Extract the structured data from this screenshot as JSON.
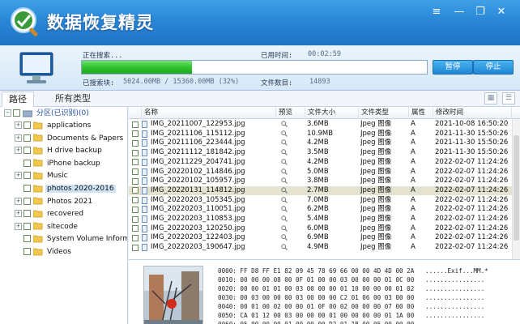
{
  "app": {
    "title": "数据恢复精灵",
    "window_controls": [
      "minimize-icon",
      "restore-icon",
      "close-icon"
    ]
  },
  "progress": {
    "status_label": "正在搜索...",
    "elapsed_label": "已用时间:",
    "elapsed_value": "00:02:59",
    "scanned_label": "已搜索块:",
    "scanned_value": "5024.00MB / 15360.00MB (32%)",
    "file_count_label": "文件数目:",
    "file_count_value": "14893",
    "progress_fraction": 0.32,
    "pause_label": "暂停",
    "stop_label": "停止"
  },
  "tabs": [
    {
      "label": "路径",
      "active": true
    },
    {
      "label": "所有类型",
      "active": false
    }
  ],
  "tree": {
    "root": "分区(已识别)(0)",
    "items": [
      {
        "label": "applications",
        "expandable": true,
        "selected": false
      },
      {
        "label": "Documents & Papers",
        "expandable": true,
        "selected": false
      },
      {
        "label": "H drive backup",
        "expandable": true,
        "selected": false
      },
      {
        "label": "iPhone backup",
        "expandable": false,
        "selected": false
      },
      {
        "label": "Music",
        "expandable": true,
        "selected": false
      },
      {
        "label": "photos 2020-2016",
        "expandable": false,
        "selected": true
      },
      {
        "label": "Photos 2021",
        "expandable": true,
        "selected": false
      },
      {
        "label": "recovered",
        "expandable": true,
        "selected": false
      },
      {
        "label": "sitecode",
        "expandable": true,
        "selected": false
      },
      {
        "label": "System Volume Inform",
        "expandable": false,
        "selected": false
      },
      {
        "label": "Videos",
        "expandable": false,
        "selected": false
      }
    ]
  },
  "table": {
    "columns": {
      "name": "名称",
      "preview": "预览",
      "size": "文件大小",
      "type": "文件类型",
      "attr": "属性",
      "modified": "修改时间"
    },
    "rows": [
      {
        "name": "IMG_20211007_122953.jpg",
        "size": "3.6MB",
        "type": "Jpeg 图像",
        "attr": "A",
        "modified": "2021-10-08 16:50:20",
        "selected": false
      },
      {
        "name": "IMG_20211106_115112.jpg",
        "size": "10.9MB",
        "type": "Jpeg 图像",
        "attr": "A",
        "modified": "2021-11-30 15:50:26",
        "selected": false
      },
      {
        "name": "IMG_20211106_223444.jpg",
        "size": "4.2MB",
        "type": "Jpeg 图像",
        "attr": "A",
        "modified": "2021-11-30 15:50:26",
        "selected": false
      },
      {
        "name": "IMG_20211112_181842.jpg",
        "size": "3.5MB",
        "type": "Jpeg 图像",
        "attr": "A",
        "modified": "2021-11-30 15:50:26",
        "selected": false
      },
      {
        "name": "IMG_20211229_204741.jpg",
        "size": "4.2MB",
        "type": "Jpeg 图像",
        "attr": "A",
        "modified": "2022-02-07 11:24:26",
        "selected": false
      },
      {
        "name": "IMG_20220102_114846.jpg",
        "size": "5.0MB",
        "type": "Jpeg 图像",
        "attr": "A",
        "modified": "2022-02-07 11:24:26",
        "selected": false
      },
      {
        "name": "IMG_20220102_105957.jpg",
        "size": "3.8MB",
        "type": "Jpeg 图像",
        "attr": "A",
        "modified": "2022-02-07 11:24:26",
        "selected": false
      },
      {
        "name": "IMG_20220131_114812.jpg",
        "size": "2.7MB",
        "type": "Jpeg 图像",
        "attr": "A",
        "modified": "2022-02-07 11:24:26",
        "selected": true
      },
      {
        "name": "IMG_20220203_105345.jpg",
        "size": "7.0MB",
        "type": "Jpeg 图像",
        "attr": "A",
        "modified": "2022-02-07 11:24:26",
        "selected": false
      },
      {
        "name": "IMG_20220203_110051.jpg",
        "size": "6.2MB",
        "type": "Jpeg 图像",
        "attr": "A",
        "modified": "2022-02-07 11:24:26",
        "selected": false
      },
      {
        "name": "IMG_20220203_110853.jpg",
        "size": "5.4MB",
        "type": "Jpeg 图像",
        "attr": "A",
        "modified": "2022-02-07 11:24:26",
        "selected": false
      },
      {
        "name": "IMG_20220203_120250.jpg",
        "size": "6.0MB",
        "type": "Jpeg 图像",
        "attr": "A",
        "modified": "2022-02-07 11:24:26",
        "selected": false
      },
      {
        "name": "IMG_20220203_122403.jpg",
        "size": "6.9MB",
        "type": "Jpeg 图像",
        "attr": "A",
        "modified": "2022-02-07 11:24:26",
        "selected": false
      },
      {
        "name": "IMG_20220203_190647.jpg",
        "size": "4.9MB",
        "type": "Jpeg 图像",
        "attr": "A",
        "modified": "2022-02-07 11:24:26",
        "selected": false
      }
    ]
  },
  "hex": {
    "lines": [
      "0000: FF D8 FF E1 82 09 45 78 69 66 00 00 4D 4D 00 2A   ......Exif...MM.*",
      "0010: 00 00 00 08 00 0F 01 00 00 03 00 00 00 01 0C 00   ................",
      "0020: 00 00 01 01 00 03 00 00 00 01 10 00 00 00 01 02   ................",
      "0030: 00 03 00 00 00 03 00 00 00 C2 01 06 00 03 00 00   ................",
      "0040: 00 01 00 02 00 00 01 0F 00 02 00 00 00 07 00 00   ................",
      "0050: CA 01 12 00 03 00 00 00 01 00 00 00 00 01 1A 00   ................",
      "0060: 05 00 00 00 01 00 00 00 D2 01 1B 00 05 00 00 00   ................"
    ]
  }
}
